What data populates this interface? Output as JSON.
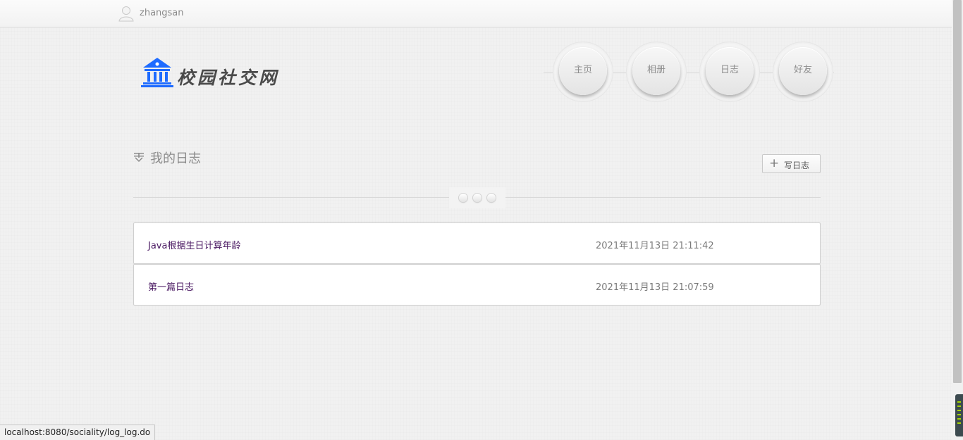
{
  "header": {
    "username": "zhangsan",
    "site_name": "校园社交网"
  },
  "nav": [
    {
      "label": "主页"
    },
    {
      "label": "相册"
    },
    {
      "label": "日志"
    },
    {
      "label": "好友"
    }
  ],
  "section": {
    "title": "我的日志",
    "write_button": "写日志"
  },
  "logs": [
    {
      "title": "Java根据生日计算年龄",
      "date": "2021年11月13日 21:11:42"
    },
    {
      "title": "第一篇日志",
      "date": "2021年11月13日 21:07:59"
    }
  ],
  "status_bar": {
    "url": "localhost:8080/sociality/log_log.do"
  },
  "colors": {
    "link": "#4b1a63",
    "logo_blue": "#1e6bff"
  }
}
